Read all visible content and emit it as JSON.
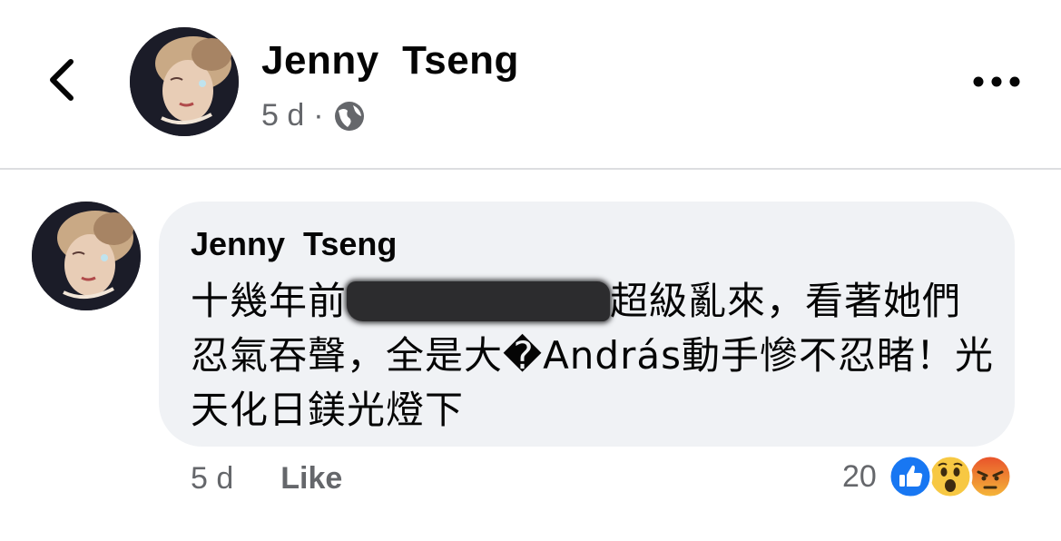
{
  "post": {
    "author": "Jenny  Tseng",
    "time": "5 d",
    "separator": "·",
    "audience_icon": "globe-icon"
  },
  "comment": {
    "author": "Jenny  Tseng",
    "text_before": "十幾年前",
    "text_after": "超級亂來，看著她們忍氣吞聲，全是大�András動手慘不忍睹！光天化日鎂光燈下",
    "time": "5 d",
    "like_label": "Like",
    "reaction_count": "20",
    "reactions": [
      "like-reaction-icon",
      "wow-reaction-icon",
      "angry-reaction-icon"
    ]
  },
  "colors": {
    "bubble": "#f0f2f5",
    "secondary_text": "#65676b",
    "like_blue": "#1877f2"
  }
}
